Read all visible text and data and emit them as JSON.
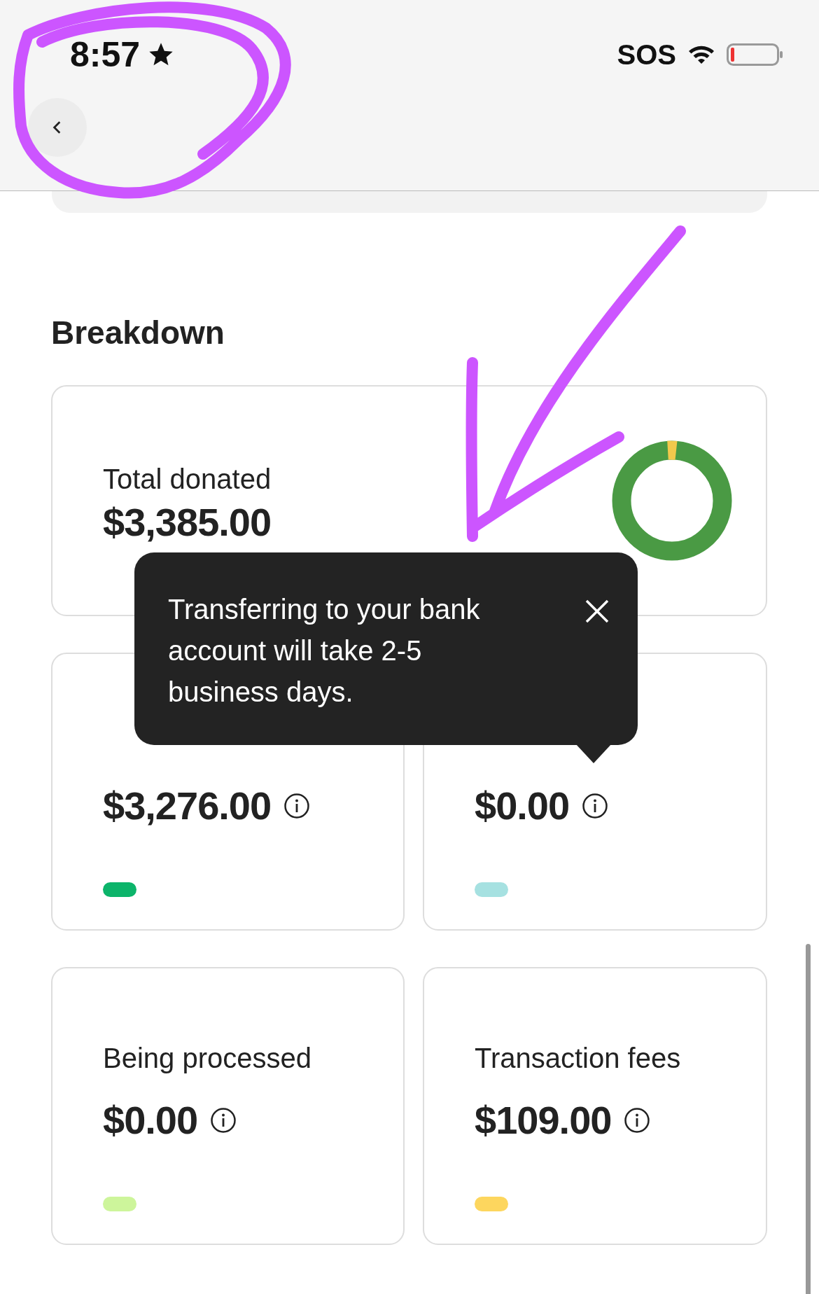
{
  "status_bar": {
    "time": "8:57",
    "sos": "SOS"
  },
  "section_title": "Breakdown",
  "total": {
    "label": "Total donated",
    "value": "$3,385.00"
  },
  "stats": [
    {
      "value": "$3,276.00",
      "color": "#0cb46a"
    },
    {
      "value": "$0.00",
      "color": "#a6e1e1"
    },
    {
      "label": "Being processed",
      "value": "$0.00",
      "color": "#cdf59b"
    },
    {
      "label": "Transaction fees",
      "value": "$109.00",
      "color": "#fdd65e"
    }
  ],
  "tooltip": {
    "text": "Transferring to your bank account will take 2-5 business days."
  },
  "annotations": {
    "circle": true,
    "arrow": true
  }
}
